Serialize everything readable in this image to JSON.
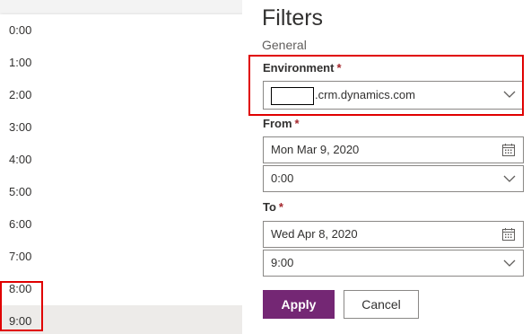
{
  "time_list": {
    "items": [
      "0:00",
      "1:00",
      "2:00",
      "3:00",
      "4:00",
      "5:00",
      "6:00",
      "7:00",
      "8:00",
      "9:00"
    ],
    "selected_index": 9
  },
  "filters": {
    "title": "Filters",
    "section": "General",
    "environment": {
      "label": "Environment",
      "required_mark": "*",
      "value_suffix": ".crm.dynamics.com"
    },
    "from": {
      "label": "From",
      "required_mark": "*",
      "date": "Mon Mar 9, 2020",
      "time": "0:00"
    },
    "to": {
      "label": "To",
      "required_mark": "*",
      "date": "Wed Apr 8, 2020",
      "time": "9:00"
    },
    "apply_label": "Apply",
    "cancel_label": "Cancel"
  },
  "colors": {
    "apply_bg": "#742774",
    "required": "#a4262c",
    "highlight": "#e00000"
  }
}
